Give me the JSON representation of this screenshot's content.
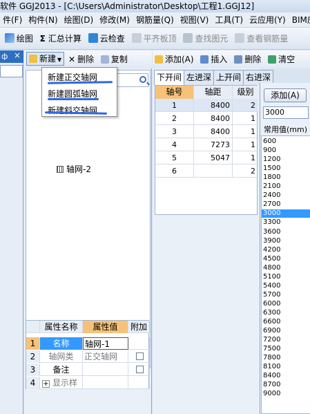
{
  "window": {
    "title": "软件 GGJ2013 - [C:\\Users\\Administrator\\Desktop\\工程1.GGJ12]"
  },
  "menu": [
    "件(F)",
    "构件(N)",
    "绘图(D)",
    "修改(M)",
    "钢筋量(Q)",
    "视图(V)",
    "工具(T)",
    "云应用(Y)",
    "BIM应用"
  ],
  "toolbar": {
    "draw": "绘图",
    "sum": "汇总计算",
    "cloud_check": "云检查",
    "flat_slab": "平齐板顶",
    "find": "查找图元",
    "view_rebar": "查看钢筋量"
  },
  "leftdock": {
    "title": "ф",
    "close": "×"
  },
  "tree": {
    "new_label": "新建",
    "delete_label": "删除",
    "copy_label": "复制",
    "dropdown": [
      "新建正交轴网",
      "新建圆弧轴网",
      "新建斜交轴网"
    ],
    "node": "轴网-2"
  },
  "props": {
    "headers": [
      "属性名称",
      "属性值",
      "附加"
    ],
    "rows": [
      {
        "n": "1",
        "name": "名称",
        "value": "轴网-1"
      },
      {
        "n": "2",
        "name": "轴网类",
        "value": "正交轴网"
      },
      {
        "n": "3",
        "name": "备注",
        "value": ""
      },
      {
        "n": "4",
        "name": "显示样",
        "value": "",
        "expand": "+"
      }
    ]
  },
  "gridtools": {
    "add": "添加(A)",
    "insert": "插入",
    "delete": "删除",
    "clear": "清空"
  },
  "tabs": [
    "下开间",
    "左进深",
    "上开间",
    "右进深"
  ],
  "grid": {
    "headers": [
      "轴号",
      "轴距",
      "级别"
    ],
    "rows": [
      [
        "1",
        "8400",
        "2"
      ],
      [
        "2",
        "8400",
        "1"
      ],
      [
        "3",
        "8400",
        "1"
      ],
      [
        "4",
        "7273",
        "1"
      ],
      [
        "5",
        "5047",
        "1"
      ],
      [
        "6",
        "",
        "2"
      ]
    ]
  },
  "right": {
    "add": "添加(A)",
    "value": "3000",
    "common_label": "常用值(mm)",
    "values": [
      "600",
      "900",
      "1200",
      "1500",
      "1800",
      "2100",
      "2400",
      "2700",
      "3000",
      "3300",
      "3600",
      "3900",
      "4200",
      "4500",
      "4800",
      "5100",
      "5400",
      "5700",
      "6000",
      "6300",
      "6600",
      "6900",
      "7200",
      "7500",
      "7800",
      "8100",
      "8400",
      "8700",
      "9000"
    ],
    "selected": "3000"
  },
  "colors": {
    "accent": "#3399ff",
    "header_orange": "#f6c27a",
    "ink": "#2b6ae0"
  }
}
